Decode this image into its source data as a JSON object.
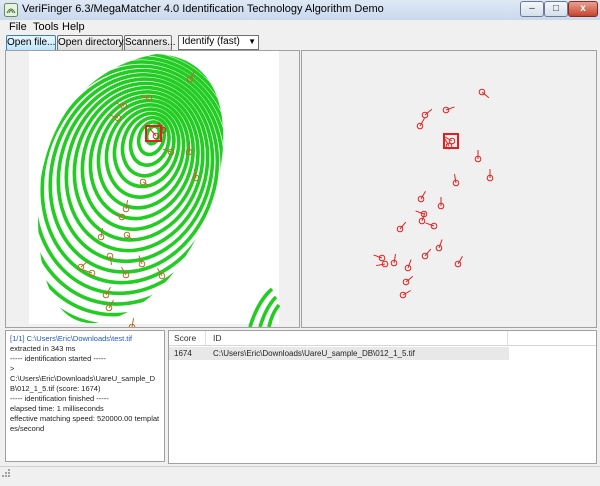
{
  "window": {
    "title": "VeriFinger 6.3/MegaMatcher 4.0 Identification Technology Algorithm Demo",
    "controls": [
      "–",
      "□",
      "x"
    ]
  },
  "menu": {
    "file": "File",
    "tools": "Tools",
    "help": "Help"
  },
  "toolbar": {
    "open_file": "Open file...",
    "open_directory": "Open directory...",
    "scanners": "Scanners...",
    "mode_selected": "Identify (fast)"
  },
  "log": {
    "lines": [
      "[1/1] C:\\Users\\Eric\\Downloads\\test.tif",
      "extracted in 343 ms",
      "----- identification started -----",
      ">",
      "C:\\Users\\Eric\\Downloads\\UareU_sample_DB\\012_1_5.tif (score: 1674)",
      "----- identification finished -----",
      "elapsed time: 1 milliseconds",
      "effective matching speed: 520000.00 templates/second"
    ]
  },
  "results": {
    "columns": [
      "Score",
      "ID"
    ],
    "rows": [
      {
        "score": "1674",
        "id": "C:\\Users\\Eric\\Downloads\\UareU_sample_DB\\012_1_5.tif"
      }
    ]
  },
  "colors": {
    "ridge_green": "#22cc22",
    "minutia_red": "#e02020",
    "link_blue": "#2456c4"
  },
  "icons": {
    "app": "fingerprint-app-icon",
    "resize": "resize-grip-icon"
  }
}
